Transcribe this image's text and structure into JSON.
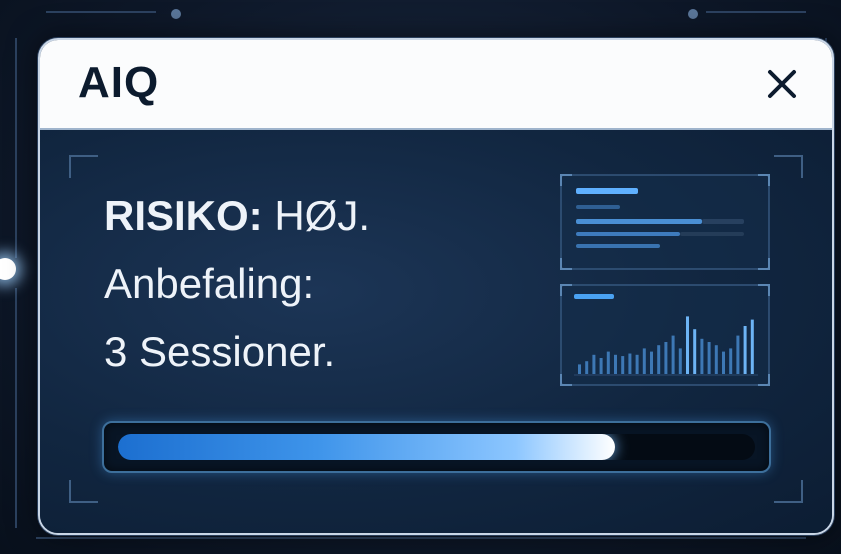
{
  "window": {
    "title": "AIQ",
    "close_label": "close"
  },
  "message": {
    "risk_label": "RISIKO:",
    "risk_value": "HØJ.",
    "recommendation_label": "Anbefaling:",
    "recommendation_value": "3 Sessioner."
  },
  "progress": {
    "value_fraction": 0.78
  },
  "chart_panel": {
    "bar_levels": [
      0.15,
      0.2,
      0.3,
      0.25,
      0.35,
      0.3,
      0.28,
      0.32,
      0.3,
      0.4,
      0.35,
      0.45,
      0.5,
      0.6,
      0.4,
      0.9,
      0.7,
      0.55,
      0.5,
      0.45,
      0.35,
      0.4,
      0.6,
      0.75,
      0.85
    ]
  },
  "colors": {
    "accent": "#3e94ea",
    "title_text": "#0c1b2e",
    "body_text": "#eef3f9"
  }
}
